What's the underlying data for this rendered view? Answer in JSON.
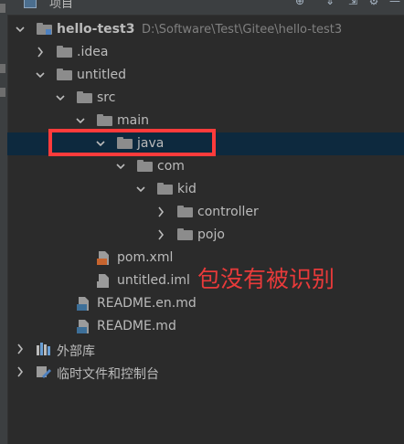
{
  "header": {
    "title": "项目",
    "buttons": [
      "⊕",
      "⇕",
      "⇲",
      "⚙",
      "—"
    ]
  },
  "tree": [
    {
      "label": "hello-test3",
      "path": "D:\\Software\\Test\\Gitee\\hello-test3",
      "type": "module",
      "state": "expanded",
      "depth": 0,
      "bold": true
    },
    {
      "label": ".idea",
      "type": "folder",
      "state": "collapsed",
      "depth": 1
    },
    {
      "label": "untitled",
      "type": "folder",
      "state": "expanded",
      "depth": 1
    },
    {
      "label": "src",
      "type": "folder",
      "state": "expanded",
      "depth": 2
    },
    {
      "label": "main",
      "type": "folder",
      "state": "expanded",
      "depth": 3
    },
    {
      "label": "java",
      "type": "folder",
      "state": "expanded",
      "depth": 4,
      "selected": true
    },
    {
      "label": "com",
      "type": "folder",
      "state": "expanded",
      "depth": 5
    },
    {
      "label": "kid",
      "type": "folder",
      "state": "expanded",
      "depth": 6
    },
    {
      "label": "controller",
      "type": "folder",
      "state": "collapsed",
      "depth": 7
    },
    {
      "label": "pojo",
      "type": "folder",
      "state": "collapsed",
      "depth": 7
    },
    {
      "label": "pom.xml",
      "type": "xml",
      "state": "none",
      "depth": 3
    },
    {
      "label": "untitled.iml",
      "type": "iml",
      "state": "none",
      "depth": 3
    },
    {
      "label": "README.en.md",
      "type": "md",
      "state": "none",
      "depth": 2
    },
    {
      "label": "README.md",
      "type": "md",
      "state": "none",
      "depth": 2
    },
    {
      "label": "外部库",
      "type": "libs",
      "state": "collapsed",
      "depth": 0
    },
    {
      "label": "临时文件和控制台",
      "type": "scratch",
      "state": "collapsed",
      "depth": 0
    }
  ],
  "annotation": "包没有被识别",
  "colors": {
    "background": "#2b2b2b",
    "selection": "#0d293e",
    "highlight": "#ff3b3b",
    "annotation": "#e83a3a"
  }
}
